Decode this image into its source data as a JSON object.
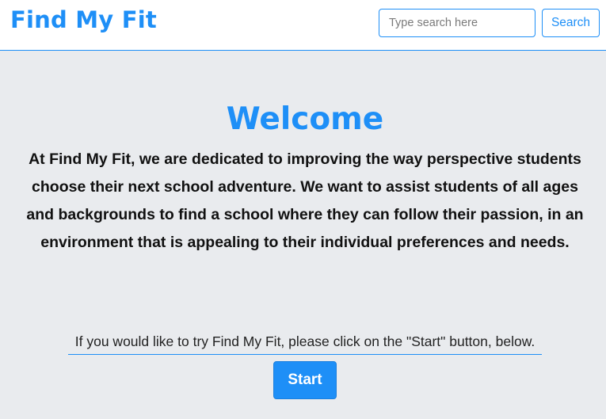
{
  "navbar": {
    "brand": "Find My Fit",
    "search": {
      "placeholder": "Type search here",
      "value": "",
      "button_label": "Search"
    }
  },
  "main": {
    "title": "Welcome",
    "intro": "At Find My Fit, we are dedicated to improving the way perspective students choose their next school adventure. We want to assist students of all ages and backgrounds to find a school where they can follow their passion, in an environment that is appealing to their individual preferences and needs.",
    "prompt": "If you would like to try Find My Fit, please click on the \"Start\" button, below.",
    "start_label": "Start"
  },
  "colors": {
    "accent": "#1e8ff7",
    "background": "#e9ebee",
    "navbar_background": "#ffffff",
    "text": "#111111"
  }
}
